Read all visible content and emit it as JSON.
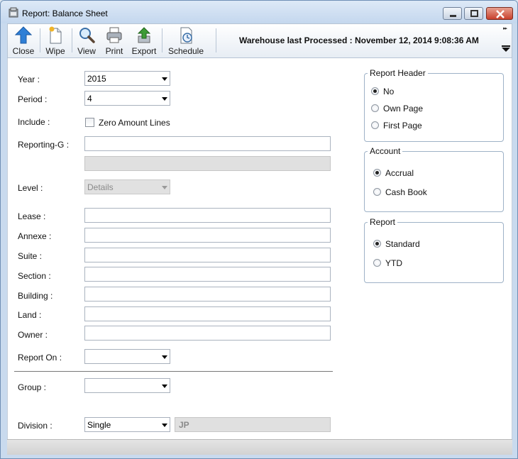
{
  "window": {
    "title": "Report: Balance Sheet"
  },
  "toolbar": {
    "close_label": "Close",
    "wipe_label": "Wipe",
    "view_label": "View",
    "print_label": "Print",
    "export_label": "Export",
    "schedule_label": "Schedule",
    "warehouse_status": "Warehouse last Processed : November 12, 2014 9:08:36 AM"
  },
  "form": {
    "year": {
      "label": "Year :",
      "value": "2015"
    },
    "period": {
      "label": "Period :",
      "value": "4"
    },
    "include": {
      "label": "Include :",
      "checkbox_label": "Zero Amount Lines",
      "checked": false
    },
    "reporting_group": {
      "label": "Reporting-G :",
      "value": "",
      "secondary_value": ""
    },
    "level": {
      "label": "Level :",
      "value": "Details"
    },
    "lease": {
      "label": "Lease :",
      "value": ""
    },
    "annexe": {
      "label": "Annexe :",
      "value": ""
    },
    "suite": {
      "label": "Suite :",
      "value": ""
    },
    "section": {
      "label": "Section :",
      "value": ""
    },
    "building": {
      "label": "Building :",
      "value": ""
    },
    "land": {
      "label": "Land :",
      "value": ""
    },
    "owner": {
      "label": "Owner :",
      "value": ""
    },
    "report_on": {
      "label": "Report On :",
      "value": ""
    },
    "group": {
      "label": "Group :",
      "value": ""
    },
    "division": {
      "label": "Division :",
      "value": "Single",
      "code": "JP"
    }
  },
  "report_header": {
    "title": "Report Header",
    "options": [
      {
        "label": "No",
        "checked": true
      },
      {
        "label": "Own Page",
        "checked": false
      },
      {
        "label": "First Page",
        "checked": false
      }
    ]
  },
  "account": {
    "title": "Account",
    "options": [
      {
        "label": "Accrual",
        "checked": true
      },
      {
        "label": "Cash Book",
        "checked": false
      }
    ]
  },
  "report": {
    "title": "Report",
    "options": [
      {
        "label": "Standard",
        "checked": true
      },
      {
        "label": "YTD",
        "checked": false
      }
    ]
  },
  "colors": {
    "title_bar": "#c4d7ee",
    "close_button": "#c8402c",
    "toolbar_icon_blue": "#2f7fd6",
    "export_icon_green": "#3d9b35"
  }
}
